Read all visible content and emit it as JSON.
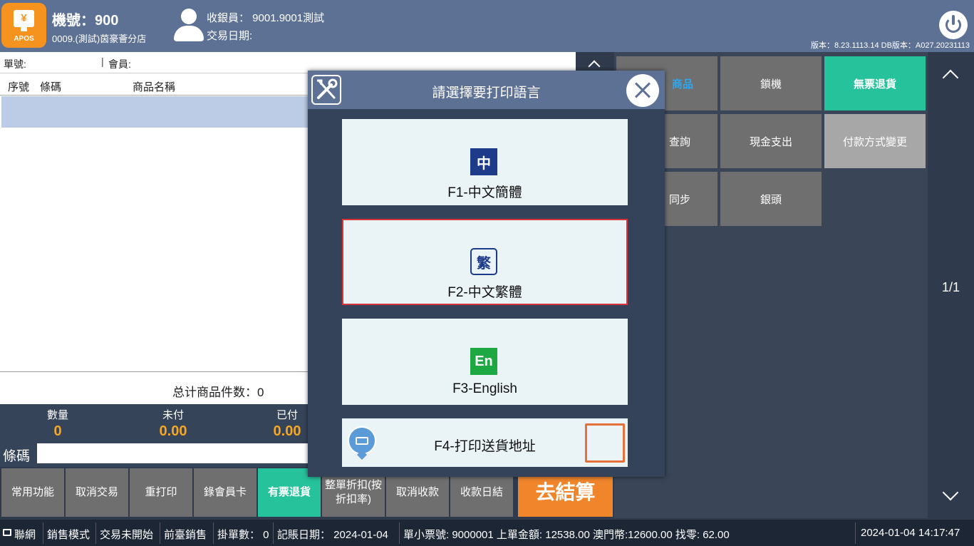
{
  "header": {
    "machine": "機號：900",
    "store": "0009.(測試)茵豪薈分店",
    "cashier": "收銀員： 9001.9001測試",
    "tx_date": "交易日期:",
    "version": "版本：8.23.1113.14 DB版本：A027.20231113",
    "logo_text": "APOS",
    "logo_symbol": "¥"
  },
  "order": {
    "order_no_label": "單號:",
    "member_label": "會員:"
  },
  "table": {
    "columns": [
      "序號",
      "條碼",
      "商品名稱"
    ]
  },
  "summary": {
    "total_label": "总计商品件数：0",
    "stats": [
      {
        "title": "數量",
        "value": "0"
      },
      {
        "title": "未付",
        "value": "0.00"
      },
      {
        "title": "已付",
        "value": "0.00"
      }
    ],
    "barcode_label": "條碼"
  },
  "toolbar": {
    "buttons": [
      "常用功能",
      "取消交易",
      "重打印",
      "錄會員卡",
      "有票退貨",
      "整單折扣(按折扣率)",
      "取消收款",
      "收款日結",
      "去結算"
    ]
  },
  "functions": {
    "buttons": [
      "商品",
      "鎖機",
      "無票退貨",
      "查詢",
      "現金支出",
      "付款方式變更",
      "同步",
      "銀頭"
    ]
  },
  "pager": {
    "page": "1/1"
  },
  "status": {
    "items": [
      "聯網",
      "銷售模式",
      "交易未開始",
      "前臺銷售",
      "掛單數： 0",
      "記賬日期： 2024-01-04",
      "單小票號: 9000001 上單金額: 12538.00 澳門幣:12600.00 找零: 62.00",
      "2024-01-04 14:17:47"
    ]
  },
  "modal": {
    "title": "請選擇要打印語言",
    "options": [
      {
        "icon_text": "中",
        "label": "F1-中文簡體"
      },
      {
        "icon_text": "繁",
        "label": "F2-中文繁體"
      },
      {
        "icon_text": "En",
        "label": "F3-English"
      }
    ],
    "address_label": "F4-打印送貨地址"
  },
  "colors": {
    "header": "#5c7193",
    "accent_green": "#26c29b",
    "accent_orange": "#f0852c",
    "value_amber": "#f5a623",
    "selected_border": "#d9353b"
  }
}
